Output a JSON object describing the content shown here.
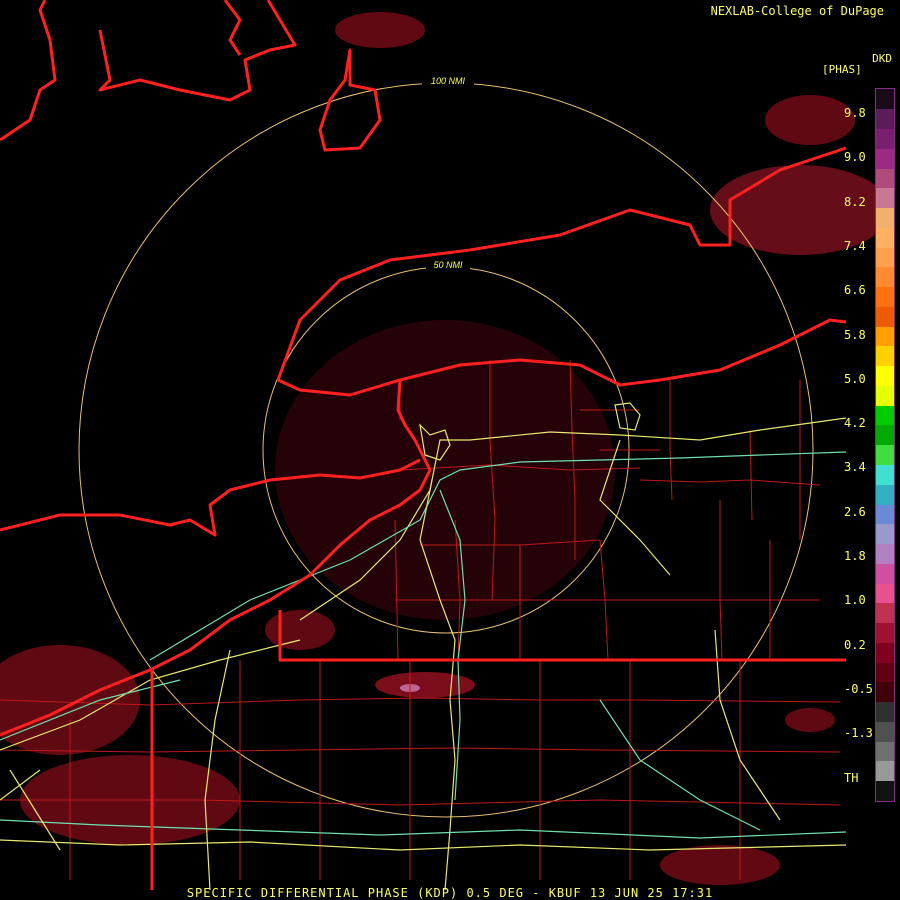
{
  "credit": "NEXLAB-College of DuPage",
  "footer": "SPECIFIC DIFFERENTIAL PHASE (KDP) 0.5 DEG - KBUF 13 JUN 25 17:31",
  "range_rings": [
    {
      "label": "100 NMI"
    },
    {
      "label": "50 NMI"
    }
  ],
  "legend": {
    "product": "DKD",
    "unit": "[PHAS]",
    "ticks": [
      "9.8",
      "9.0",
      "8.2",
      "7.4",
      "6.6",
      "5.8",
      "5.0",
      "4.2",
      "3.4",
      "2.6",
      "1.8",
      "1.0",
      "0.2",
      "-0.5",
      "-1.3",
      "TH"
    ],
    "colors": [
      "#1a0a1a",
      "#5a1d5a",
      "#7a1f6e",
      "#9c2a82",
      "#b04a7a",
      "#c87890",
      "#f2b070",
      "#ffb060",
      "#ffa050",
      "#ff8a30",
      "#ff7010",
      "#ee5a00",
      "#ffa000",
      "#ffd000",
      "#ffff00",
      "#e6ff00",
      "#00cc00",
      "#00aa00",
      "#40dd40",
      "#40e0d0",
      "#30b0c0",
      "#6a8ad8",
      "#9999cc",
      "#b080c0",
      "#d050a0",
      "#e85090",
      "#c03050",
      "#a01030",
      "#800020",
      "#600010",
      "#400008",
      "#303030",
      "#505050",
      "#707070",
      "#999999",
      "#121212"
    ]
  },
  "colors": {
    "state_border": "#ff2020",
    "county_line": "#c01818",
    "highway": "#e8e870",
    "interstate": "#70e0b0",
    "range_ring": "#e8c070",
    "echo": "#6a0a14"
  }
}
